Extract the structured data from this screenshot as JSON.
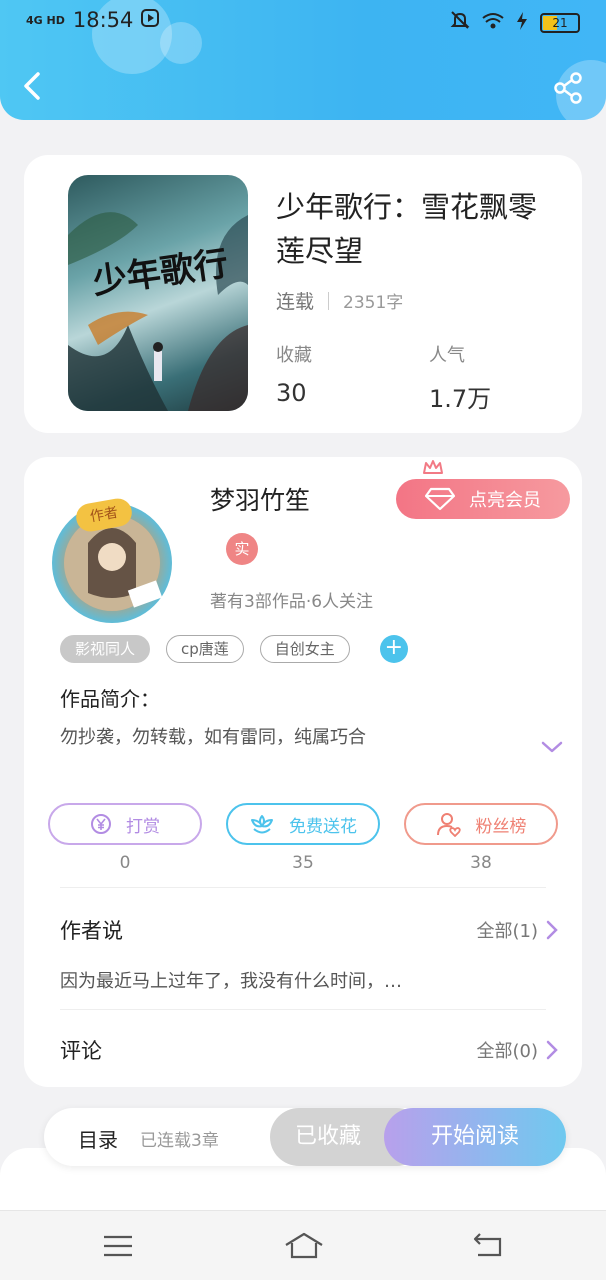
{
  "status_bar": {
    "network": "4G HD",
    "time": "18:54",
    "battery": "21"
  },
  "book": {
    "title": "少年歌行：雪花飘零莲尽望",
    "cover_text": "少年歌行",
    "status": "连载",
    "word_count": "2351字",
    "favorites_label": "收藏",
    "favorites_value": "30",
    "popularity_label": "人气",
    "popularity_value": "1.7万"
  },
  "author": {
    "badge": "作者",
    "name": "梦羽竹笙",
    "vip_label": "点亮会员",
    "real_badge": "实",
    "stats": "著有3部作品·6人关注"
  },
  "tags": [
    "影视同人",
    "cp唐莲",
    "自创女主"
  ],
  "tag_add": "+",
  "intro": {
    "heading": "作品简介：",
    "text": "勿抄袭，勿转载，如有雷同，纯属巧合"
  },
  "actions": [
    {
      "label": "打赏",
      "count": "0"
    },
    {
      "label": "免费送花",
      "count": "35"
    },
    {
      "label": "粉丝榜",
      "count": "38"
    }
  ],
  "author_says": {
    "heading": "作者说",
    "link": "全部(1)",
    "text": "因为最近马上过年了，我没有什么时间，…"
  },
  "comments": {
    "heading": "评论",
    "link": "全部(0)"
  },
  "bottom_bar": {
    "toc": "目录",
    "toc_sub": "已连载3章",
    "collected": "已收藏",
    "read": "开始阅读"
  },
  "colors": {
    "header": "#3db4f2",
    "vip": "#f37585",
    "reward": "#b28ce3",
    "flower": "#4cc3ec",
    "fans": "#ef8073"
  }
}
